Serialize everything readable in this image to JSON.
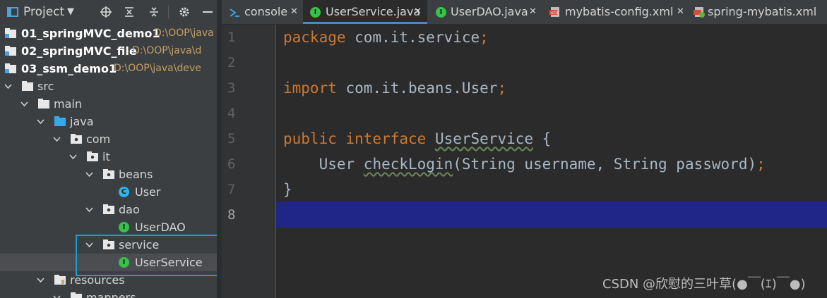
{
  "project_panel": {
    "title": "Project",
    "tree": [
      {
        "label": "01_springMVC_demo1",
        "path": "D:\\OOP\\java"
      },
      {
        "label": "02_springMVC_file",
        "path": "D:\\OOP\\java\\d"
      },
      {
        "label": "03_ssm_demo1",
        "path": "D:\\OOP\\java\\deve"
      },
      {
        "label": "src"
      },
      {
        "label": "main"
      },
      {
        "label": "java"
      },
      {
        "label": "com"
      },
      {
        "label": "it"
      },
      {
        "label": "beans"
      },
      {
        "label": "User"
      },
      {
        "label": "dao"
      },
      {
        "label": "UserDAO"
      },
      {
        "label": "service"
      },
      {
        "label": "UserService"
      },
      {
        "label": "resources"
      },
      {
        "label": "mappers"
      }
    ]
  },
  "tabs": [
    {
      "label": "console"
    },
    {
      "label": "UserService.java"
    },
    {
      "label": "UserDAO.java"
    },
    {
      "label": "mybatis-config.xml"
    },
    {
      "label": "spring-mybatis.xml"
    }
  ],
  "editor": {
    "line_numbers": [
      "1",
      "2",
      "3",
      "4",
      "5",
      "6",
      "7",
      "8"
    ],
    "code": {
      "l1_kw": "package",
      "l1_rest": " com.it.service",
      "l1_semi": ";",
      "l3_kw": "import",
      "l3_rest": " com.it.beans.User",
      "l3_semi": ";",
      "l5_kw1": "public",
      "l5_kw2": " interface ",
      "l5_type": "UserService",
      "l5_rest": " {",
      "l6_pre": "    User ",
      "l6_meth": "checkLogin",
      "l6_rest": "(String username, String password)",
      "l6_semi": ";",
      "l7": "}"
    }
  },
  "watermark": "CSDN @欣慰的三叶草(●￣(ｴ)￣●)",
  "colors": {
    "accent": "#4a88c7",
    "current_line": "#1f2687",
    "interface_icon": "#35c34a",
    "class_icon": "#2ab4f1",
    "highlight_box": "#1e9bd7"
  }
}
